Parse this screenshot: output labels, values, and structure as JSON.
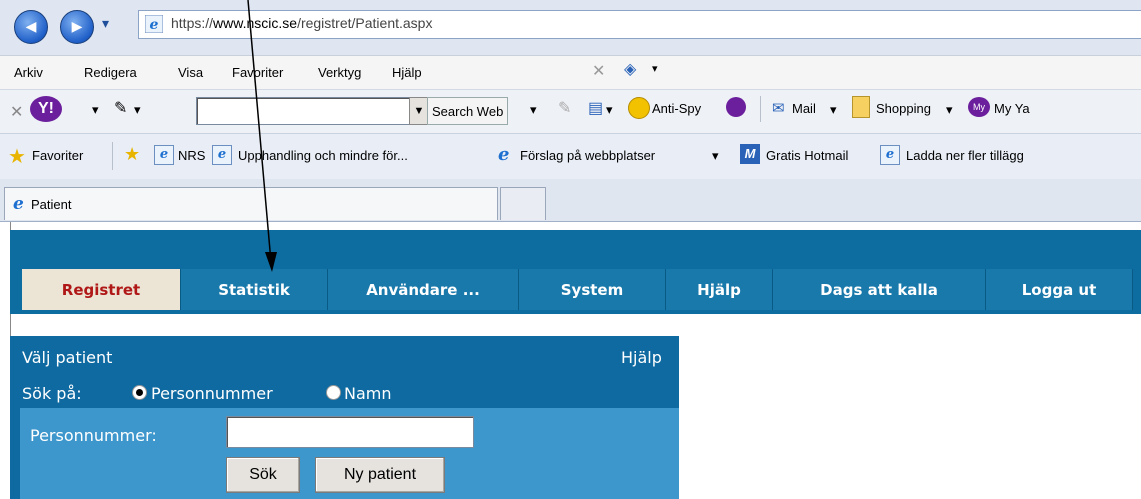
{
  "browser": {
    "back_glyph": "◀",
    "forward_glyph": "▶",
    "dropdown_glyph": "▾",
    "url_prefix": "https://",
    "url_domain": "www.nscic.se",
    "url_path": "/registret/Patient.aspx",
    "menu": [
      "Arkiv",
      "Redigera",
      "Visa",
      "Favoriter",
      "Verktyg",
      "Hjälp"
    ],
    "toolbar": {
      "search_button": "Search Web",
      "anti_spy": "Anti-Spy",
      "mail": "Mail",
      "shopping": "Shopping",
      "my_ya": "My Ya"
    },
    "favorites": {
      "label": "Favoriter",
      "items": [
        "NRS",
        "Upphandling och mindre för...",
        "Förslag på webbplatser",
        "Gratis Hotmail",
        "Ladda ner fler tillägg"
      ]
    },
    "tab_title": "Patient"
  },
  "app": {
    "nav": [
      "Registret",
      "Statistik",
      "Användare ...",
      "System",
      "Hjälp",
      "Dags att kalla",
      "Logga ut"
    ],
    "active_nav": "Registret",
    "panel": {
      "title": "Välj patient",
      "help": "Hjälp",
      "search_label": "Sök på:",
      "option_personnummer": "Personnummer",
      "option_namn": "Namn",
      "field_label": "Personnummer:",
      "field_value": "",
      "search_button": "Sök",
      "new_patient_button": "Ny patient"
    }
  },
  "colors": {
    "nav_bg": "#0d6ca0",
    "active_tab_bg": "#ece5d5",
    "active_tab_text": "#b01818",
    "form_bg": "#3d97cc"
  }
}
